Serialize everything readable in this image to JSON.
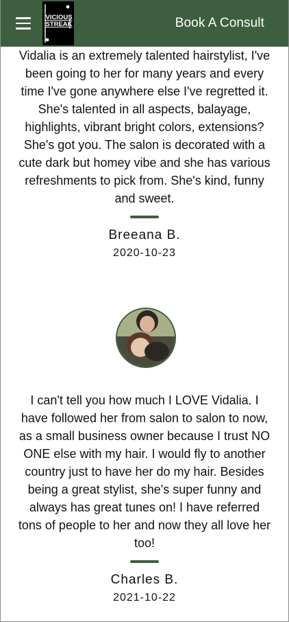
{
  "header": {
    "logo_text_line1": "VICIOUS",
    "logo_text_line2": "STREAK",
    "consult_label": "Book A Consult"
  },
  "reviews": [
    {
      "text": "Vidalia is an extremely talented hairstylist, I've been going to her for many years and every time I've gone anywhere else I've regretted it. She's talented in all aspects, balayage, highlights, vibrant bright colors, extensions? She's got you. The salon is decorated with a cute dark but homey vibe and she has various refreshments to pick from. She's kind, funny and sweet.",
      "name": "Breeana B.",
      "date": "2020-10-23"
    },
    {
      "text": "I can't tell you how much I LOVE Vidalia. I have followed her from salon to salon to now, as a small business owner because I trust NO ONE else with my hair. I would fly to another country just to have her do my hair. Besides being a great stylist, she's super funny and always has great tunes on! I have referred tons of people to her and now they all love her too!",
      "name": "Charles B.",
      "date": "2021-10-22"
    }
  ],
  "colors": {
    "brand_green": "#3e5f3f",
    "header_text": "#ffffff",
    "body_text": "#111111"
  },
  "icons": {
    "menu": "hamburger-menu-icon",
    "logo": "vicious-streak-logo"
  }
}
